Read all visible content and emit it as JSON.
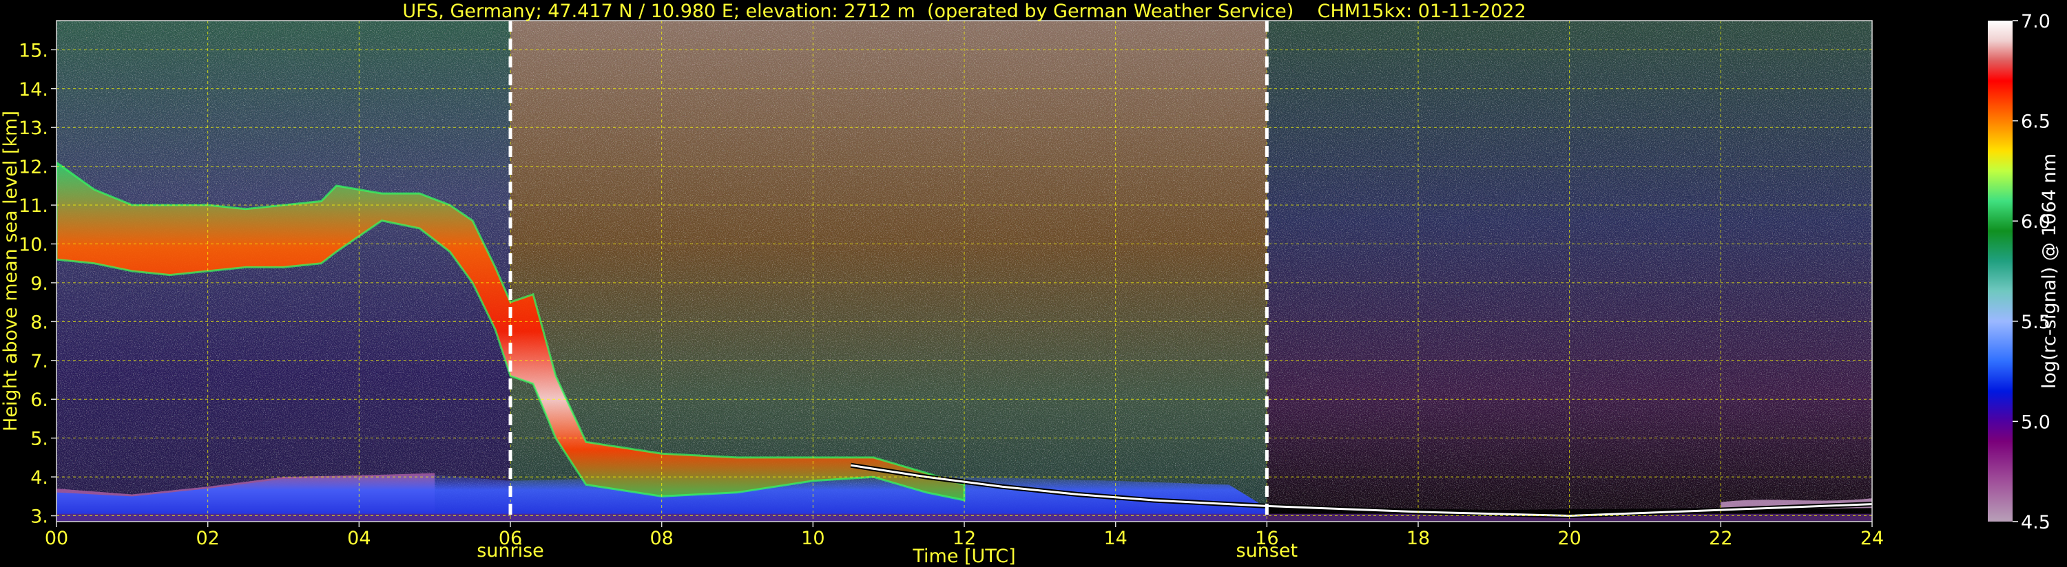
{
  "chart_data": {
    "type": "heatmap",
    "title": "UFS, Germany; 47.417 N / 10.980 E; elevation: 2712 m  (operated by German Weather Service)    CHM15kx: 01-11-2022",
    "xlabel": "Time [UTC]",
    "ylabel": "Height above mean sea level [km]",
    "colorbar_label": "log(rc-signal) @ 1064 nm",
    "xlim": [
      0,
      24
    ],
    "ylim": [
      2.85,
      15.75
    ],
    "xticks": [
      0,
      2,
      4,
      6,
      8,
      10,
      12,
      14,
      16,
      18,
      20,
      22,
      24
    ],
    "xtick_labels": [
      "00",
      "02",
      "04",
      "06",
      "08",
      "10",
      "12",
      "14",
      "16",
      "18",
      "20",
      "22",
      "24"
    ],
    "yticks": [
      3,
      4,
      5,
      6,
      7,
      8,
      9,
      10,
      11,
      12,
      13,
      14,
      15
    ],
    "ytick_labels": [
      "3.",
      "4.",
      "5.",
      "6.",
      "7.",
      "8.",
      "9.",
      "10.",
      "11.",
      "12.",
      "13.",
      "14.",
      "15."
    ],
    "colorbar_range": [
      4.5,
      7.0
    ],
    "colorbar_ticks": [
      4.5,
      5.0,
      5.5,
      6.0,
      6.5,
      7.0
    ],
    "colorbar_tick_labels": [
      "4.5",
      "5.0",
      "5.5",
      "6.0",
      "6.5",
      "7.0"
    ],
    "grid": true,
    "events": [
      {
        "label": "sunrise",
        "x": 6.0
      },
      {
        "label": "sunset",
        "x": 16.0
      }
    ],
    "features": {
      "cirrus_layer": [
        {
          "x": 0.0,
          "y_lo": 9.6,
          "y_hi": 12.1
        },
        {
          "x": 0.5,
          "y_lo": 9.5,
          "y_hi": 11.4
        },
        {
          "x": 1.0,
          "y_lo": 9.3,
          "y_hi": 11.0
        },
        {
          "x": 1.5,
          "y_lo": 9.2,
          "y_hi": 11.0
        },
        {
          "x": 2.0,
          "y_lo": 9.3,
          "y_hi": 11.0
        },
        {
          "x": 2.5,
          "y_lo": 9.4,
          "y_hi": 10.9
        },
        {
          "x": 3.0,
          "y_lo": 9.4,
          "y_hi": 11.0
        },
        {
          "x": 3.5,
          "y_lo": 9.5,
          "y_hi": 11.1
        },
        {
          "x": 3.7,
          "y_lo": 9.8,
          "y_hi": 11.5
        },
        {
          "x": 4.3,
          "y_lo": 10.6,
          "y_hi": 11.3
        },
        {
          "x": 4.8,
          "y_lo": 10.4,
          "y_hi": 11.3
        },
        {
          "x": 5.2,
          "y_lo": 9.8,
          "y_hi": 11.0
        },
        {
          "x": 5.5,
          "y_lo": 9.0,
          "y_hi": 10.6
        },
        {
          "x": 5.8,
          "y_lo": 7.8,
          "y_hi": 9.4
        },
        {
          "x": 6.0,
          "y_lo": 6.6,
          "y_hi": 8.5
        },
        {
          "x": 6.3,
          "y_lo": 6.4,
          "y_hi": 8.7
        },
        {
          "x": 6.6,
          "y_lo": 5.0,
          "y_hi": 6.6
        },
        {
          "x": 7.0,
          "y_lo": 3.8,
          "y_hi": 4.9
        },
        {
          "x": 8.0,
          "y_lo": 3.5,
          "y_hi": 4.6
        },
        {
          "x": 9.0,
          "y_lo": 3.6,
          "y_hi": 4.5
        },
        {
          "x": 10.0,
          "y_lo": 3.9,
          "y_hi": 4.5
        },
        {
          "x": 10.8,
          "y_lo": 4.0,
          "y_hi": 4.5
        },
        {
          "x": 11.5,
          "y_lo": 3.6,
          "y_hi": 4.1
        },
        {
          "x": 12.0,
          "y_lo": 3.4,
          "y_hi": 3.8
        }
      ],
      "boundary_layer_top": [
        {
          "x": 0.0,
          "y": 3.6
        },
        {
          "x": 1.0,
          "y": 3.5
        },
        {
          "x": 2.0,
          "y": 3.7
        },
        {
          "x": 3.0,
          "y": 3.95
        },
        {
          "x": 4.0,
          "y": 4.0
        },
        {
          "x": 5.0,
          "y": 4.05
        },
        {
          "x": 6.0,
          "y": 3.9
        },
        {
          "x": 8.0,
          "y": 4.0
        },
        {
          "x": 10.0,
          "y": 4.1
        },
        {
          "x": 12.0,
          "y": 4.0
        },
        {
          "x": 14.0,
          "y": 3.9
        },
        {
          "x": 15.5,
          "y": 3.8
        },
        {
          "x": 16.0,
          "y": 3.2
        }
      ],
      "residual_layer": [
        {
          "x": 10.5,
          "y": 4.3
        },
        {
          "x": 11.5,
          "y": 4.0
        },
        {
          "x": 12.5,
          "y": 3.75
        },
        {
          "x": 13.5,
          "y": 3.55
        },
        {
          "x": 14.5,
          "y": 3.4
        },
        {
          "x": 15.5,
          "y": 3.3
        },
        {
          "x": 16.0,
          "y": 3.25
        },
        {
          "x": 18.0,
          "y": 3.1
        },
        {
          "x": 20.0,
          "y": 3.0
        },
        {
          "x": 22.0,
          "y": 3.15
        },
        {
          "x": 24.0,
          "y": 3.3
        }
      ]
    }
  }
}
